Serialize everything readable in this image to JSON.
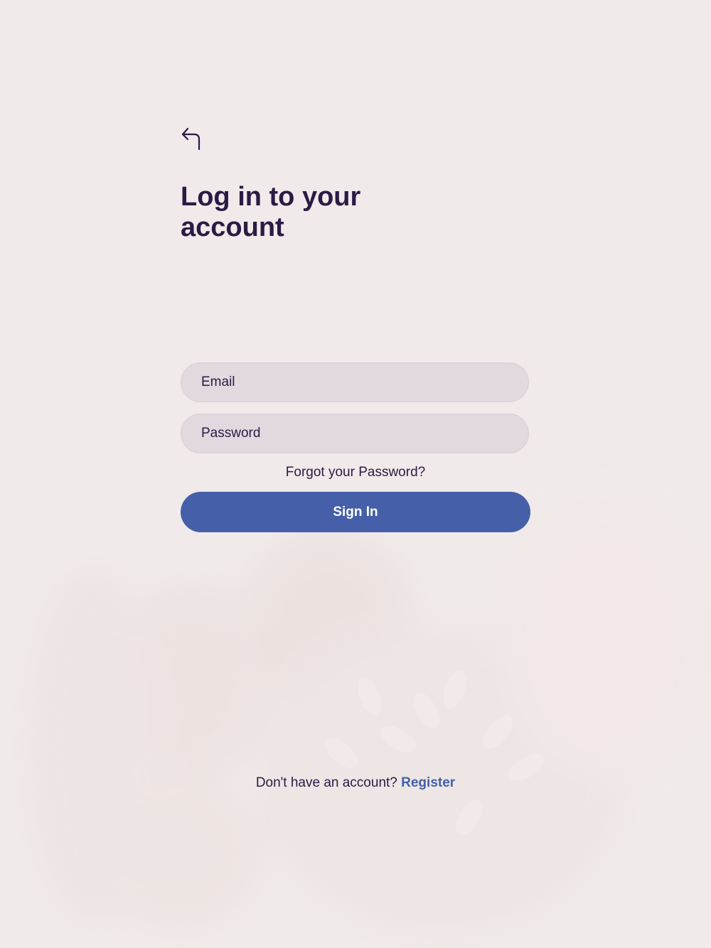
{
  "colors": {
    "background": "#f0eaea",
    "text": "#2a1b45",
    "accent": "#4560a8",
    "field_bg": "#e2d9de"
  },
  "header": {
    "back_icon": "back-arrow-icon",
    "title": "Log in to your account"
  },
  "form": {
    "email_placeholder": "Email",
    "password_placeholder": "Password",
    "forgot_label": "Forgot your Password?",
    "sign_in_label": "Sign In"
  },
  "footer": {
    "prompt": "Don't have an account?",
    "register_label": "Register"
  },
  "background_image": "faded-family-photo-with-tree"
}
